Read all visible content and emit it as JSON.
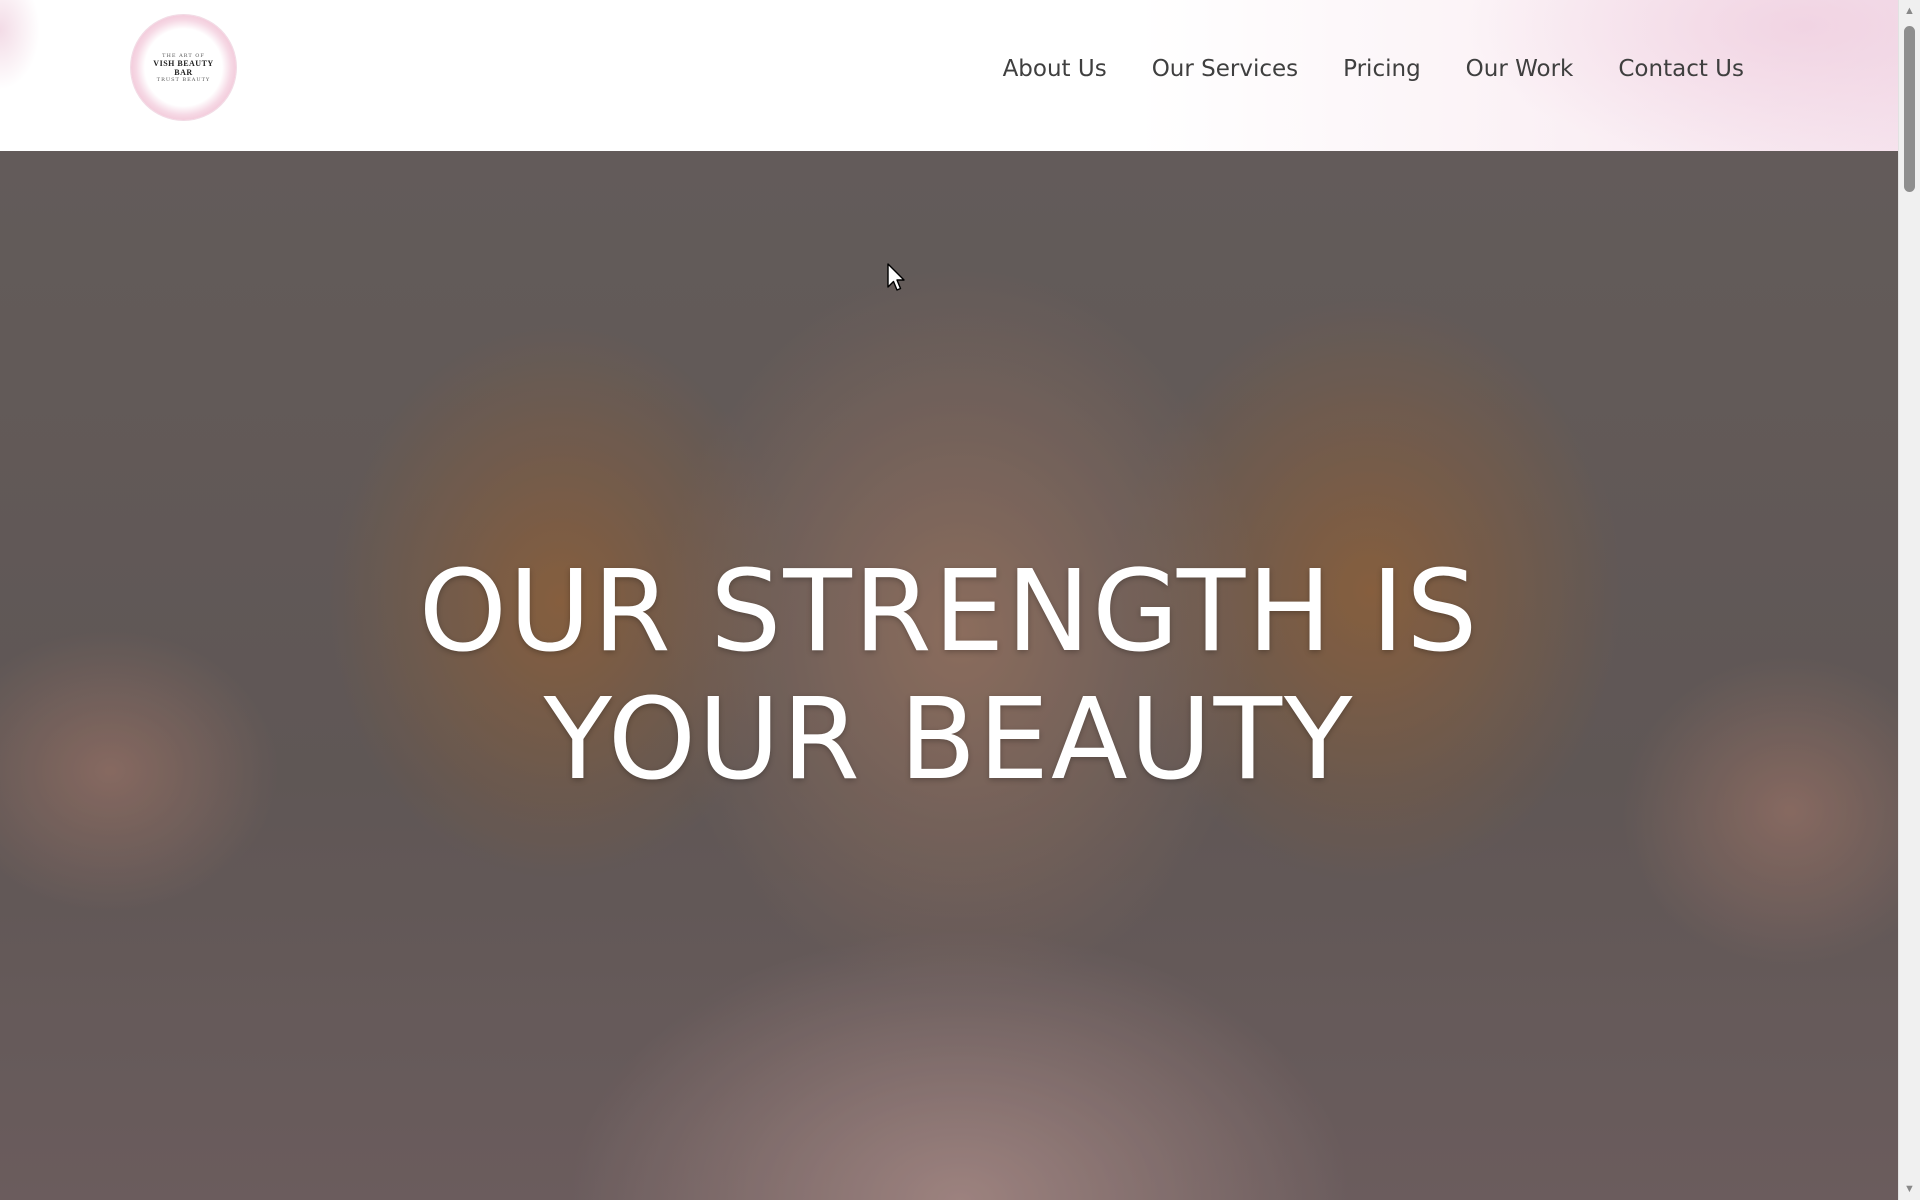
{
  "brand": {
    "logo_top_text": "THE ART OF",
    "logo_name": "VISH BEAUTY BAR",
    "logo_bottom_text": "TRUST BEAUTY"
  },
  "nav": {
    "items": [
      {
        "label": "About Us"
      },
      {
        "label": "Our Services"
      },
      {
        "label": "Pricing"
      },
      {
        "label": "Our Work"
      },
      {
        "label": "Contact Us"
      }
    ]
  },
  "hero": {
    "headline": "OUR STRENGTH IS YOUR BEAUTY"
  },
  "colors": {
    "nav_text": "#3f3f3f",
    "hero_text": "#ffffff",
    "accent_pink": "#f1c3d5"
  },
  "icons": {
    "scroll_up": "triangle-up-icon",
    "scroll_down": "triangle-down-icon",
    "cursor": "mouse-pointer-icon"
  }
}
